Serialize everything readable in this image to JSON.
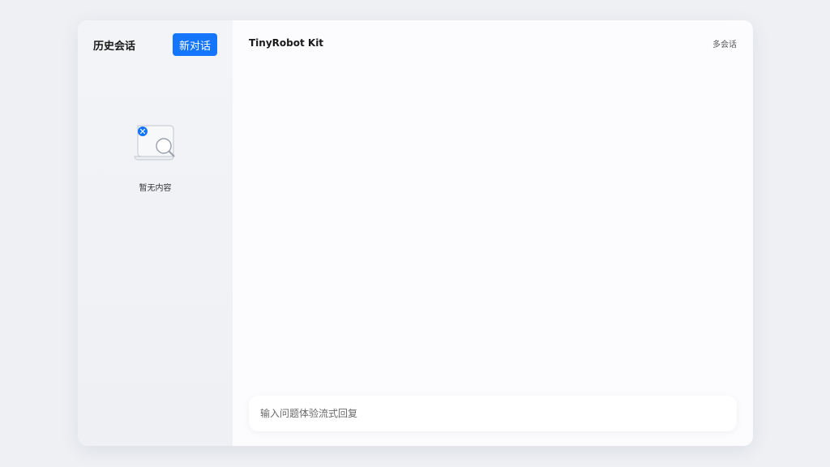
{
  "sidebar": {
    "title": "历史会话",
    "new_chat_label": "新对话",
    "empty_text": "暂无内容"
  },
  "main": {
    "title": "TinyRobot Kit",
    "multi_session_label": "多会话"
  },
  "input": {
    "placeholder": "输入问题体验流式回复"
  },
  "colors": {
    "accent": "#1476ff"
  }
}
